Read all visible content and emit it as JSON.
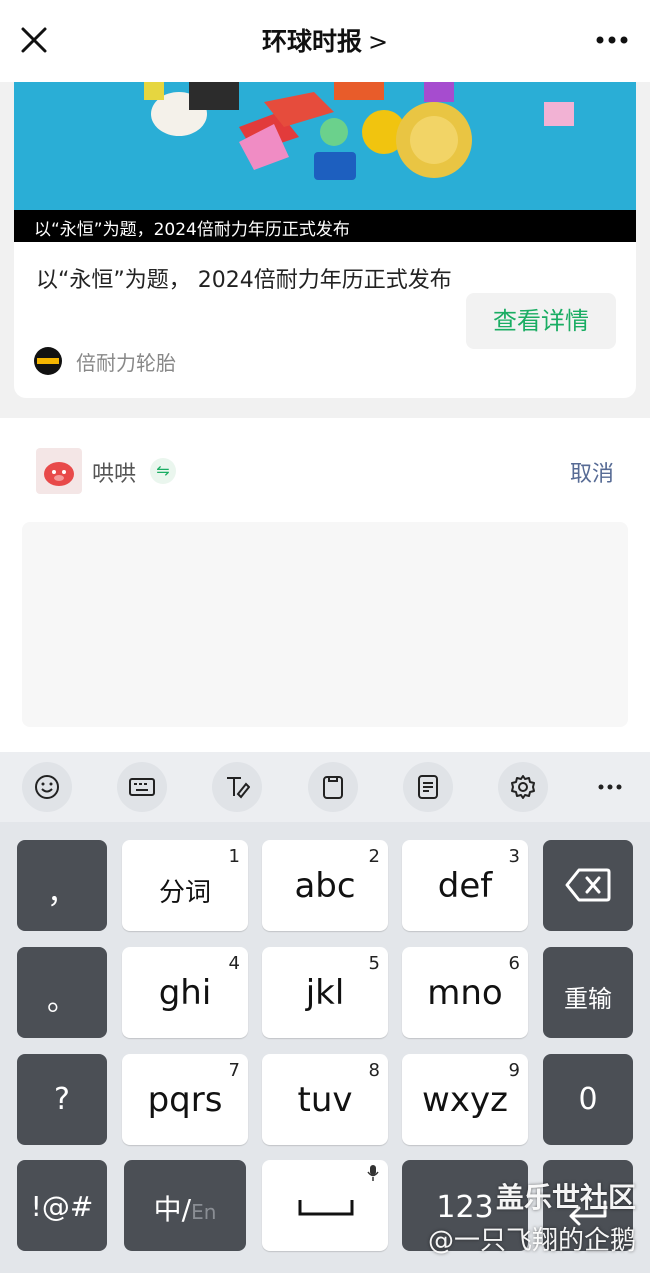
{
  "header": {
    "title": "环球时报",
    "title_chevron": ">",
    "close_icon": "close-icon",
    "more_icon": "more-icon"
  },
  "article": {
    "image_caption": "以“永恒”为题，2024倍耐力年历正式发布",
    "title": "以“永恒”为题， 2024倍耐力年历正式发布",
    "detail_button": "查看详情",
    "source_name": "倍耐力轮胎",
    "accent_color": "#1aad63"
  },
  "comment": {
    "user_name": "哄哄",
    "swap_icon": "⇋",
    "cancel_label": "取消",
    "input_value": ""
  },
  "keyboard": {
    "toolbar": [
      "emoji-icon",
      "keyboard-icon",
      "handwriting-icon",
      "clipboard-icon",
      "notes-icon",
      "settings-icon",
      "more-icon"
    ],
    "rows": [
      {
        "left": "，",
        "keys": [
          {
            "num": "1",
            "label": "分词"
          },
          {
            "num": "2",
            "label": "abc"
          },
          {
            "num": "3",
            "label": "def"
          }
        ],
        "right": "backspace-icon"
      },
      {
        "left": "。",
        "keys": [
          {
            "num": "4",
            "label": "ghi"
          },
          {
            "num": "5",
            "label": "jkl"
          },
          {
            "num": "6",
            "label": "mno"
          }
        ],
        "right": "重输"
      },
      {
        "left": "?",
        "keys": [
          {
            "num": "7",
            "label": "pqrs"
          },
          {
            "num": "8",
            "label": "tuv"
          },
          {
            "num": "9",
            "label": "wxyz"
          }
        ],
        "right": "0"
      }
    ],
    "bottom": {
      "symbols": "!@#",
      "lang_cn": "中/",
      "lang_en": "En",
      "space_icon": "space-icon",
      "numbers": "123",
      "enter_icon": "enter-icon"
    }
  },
  "watermark": {
    "line1": "盖乐世社区",
    "line2": "@一只飞翔的企鹅"
  }
}
